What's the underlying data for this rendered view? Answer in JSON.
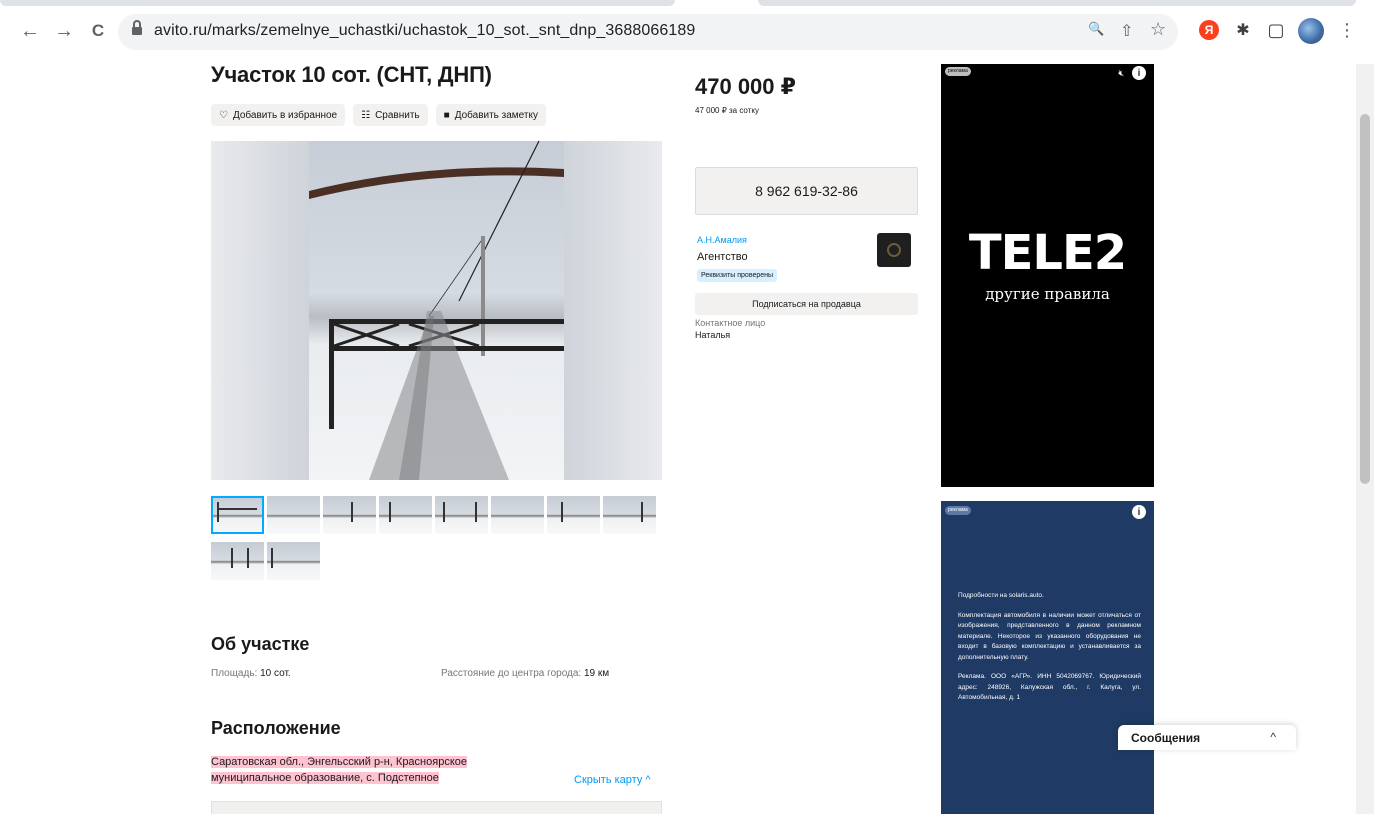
{
  "browser": {
    "url": "avito.ru/marks/zemelnye_uchastki/uchastok_10_sot._snt_dnp_3688066189",
    "back_glyph": "←",
    "forward_glyph": "→",
    "reload_glyph": "C",
    "zoom_glyph": "🔍",
    "share_glyph": "⇧",
    "star_glyph": "☆",
    "yandex_glyph": "Я",
    "puzzle_glyph": "✱",
    "sidepanel_glyph": "▢",
    "menu_glyph": "⋮"
  },
  "listing": {
    "title": "Участок 10 сот. (СНТ, ДНП)",
    "favorite_label": "Добавить в избранное",
    "compare_label": "Сравнить",
    "note_label": "Добавить заметку",
    "price": "470 000 ₽",
    "price_per": "47 000 ₽ за сотку",
    "phone": "8 962 619-32-86"
  },
  "seller": {
    "name": "А.Н.Амалия",
    "type": "Агентство",
    "badge": "Реквизиты проверены",
    "subscribe_label": "Подписаться на продавца",
    "contact_label": "Контактное лицо",
    "contact_name": "Наталья"
  },
  "about": {
    "heading": "Об участке",
    "area_label": "Площадь:",
    "area_value": "10 сот.",
    "distance_label": "Расстояние до центра города:",
    "distance_value": "19 км"
  },
  "location": {
    "heading": "Расположение",
    "address_line1": "Саратовская обл., Энгельсский р-н, Красноярское",
    "address_line2": "муниципальное образование, с. Подстепное",
    "hide_map_label": "Скрыть карту ^"
  },
  "ads": {
    "badge": "реклама",
    "info_glyph": "i",
    "tele2_brand": "TELE2",
    "tele2_slogan": "другие правила",
    "solaris_p1": "Подробности на solaris.auto.",
    "solaris_p2": "Комплектация автомобиля в наличии может отличаться от изображения, представленного в данном рекламном материале. Некоторое из указанного оборудования не входит в базовую комплектацию и устанавливается за дополнительную плату.",
    "solaris_p3": "Реклама. ООО «АГР». ИНН 5042069767. Юридический адрес: 248926, Калужская обл., г. Калуга, ул. Автомобильная, д. 1"
  },
  "messages": {
    "label": "Сообщения",
    "chevron": "^"
  },
  "colors": {
    "accent": "#0099f7",
    "address_highlight": "#ffc2d1",
    "verified_badge": "#d7f0ff",
    "ad_dark": "#000000",
    "ad_blue": "#1f3a64"
  }
}
